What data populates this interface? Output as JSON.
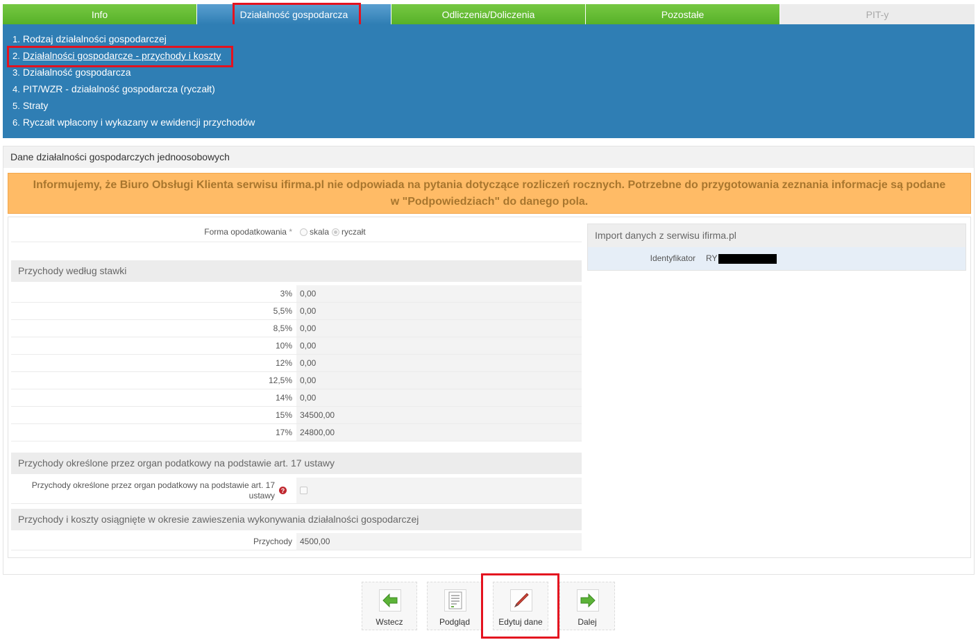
{
  "tabs": [
    {
      "label": "Info"
    },
    {
      "label": "Działalność gospodarcza"
    },
    {
      "label": "Odliczenia/Doliczenia"
    },
    {
      "label": "Pozostałe"
    },
    {
      "label": "PIT-y"
    }
  ],
  "subnav": [
    {
      "num": "1.",
      "label": "Rodzaj działalności gospodarczej"
    },
    {
      "num": "2.",
      "label": "Działalności gospodarcze - przychody i koszty"
    },
    {
      "num": "3.",
      "label": "Działalność gospodarcza"
    },
    {
      "num": "4.",
      "label": "PIT/WZR - działalność gospodarcza (ryczałt)"
    },
    {
      "num": "5.",
      "label": "Straty"
    },
    {
      "num": "6.",
      "label": "Ryczałt wpłacony i wykazany w ewidencji przychodów"
    }
  ],
  "panel": {
    "title": "Dane działalności gospodarczych jednoosobowych",
    "notice": "Informujemy, że Biuro Obsługi Klienta serwisu ifirma.pl nie odpowiada na pytania dotyczące rozliczeń rocznych. Potrzebne do przygotowania zeznania informacje są podane w \"Podpowiedziach\" do danego pola."
  },
  "form": {
    "tax_form": {
      "label": "Forma opodatkowania",
      "required": "*",
      "option_scale": "skala",
      "option_lump": "ryczałt",
      "selected": "ryczałt"
    },
    "rates_section": "Przychody według stawki",
    "rates": [
      {
        "rate": "3%",
        "value": "0,00"
      },
      {
        "rate": "5,5%",
        "value": "0,00"
      },
      {
        "rate": "8,5%",
        "value": "0,00"
      },
      {
        "rate": "10%",
        "value": "0,00"
      },
      {
        "rate": "12%",
        "value": "0,00"
      },
      {
        "rate": "12,5%",
        "value": "0,00"
      },
      {
        "rate": "14%",
        "value": "0,00"
      },
      {
        "rate": "15%",
        "value": "34500,00"
      },
      {
        "rate": "17%",
        "value": "24800,00"
      }
    ],
    "art17_section": "Przychody określone przez organ podatkowy na podstawie art. 17 ustawy",
    "art17_label": "Przychody określone przez organ podatkowy na podstawie art. 17 ustawy",
    "art17_help": "?",
    "suspension_section": "Przychody i koszty osiągnięte w okresie zawieszenia wykonywania działalności gospodarczej",
    "suspension_income": {
      "label": "Przychody",
      "value": "4500,00"
    }
  },
  "import": {
    "title": "Import danych z serwisu ifirma.pl",
    "id_label": "Identyfikator",
    "id_prefix": "RY"
  },
  "buttons": [
    {
      "label": "Wstecz",
      "icon": "arrow-left-icon"
    },
    {
      "label": "Podgląd",
      "icon": "document-preview-icon"
    },
    {
      "label": "Edytuj dane",
      "icon": "pen-icon"
    },
    {
      "label": "Dalej",
      "icon": "arrow-right-icon"
    }
  ],
  "colors": {
    "tab_green": "#57b128",
    "tab_blue": "#2f7eb4",
    "notice_bg": "#ffbb66",
    "highlight_red": "#e4121f"
  }
}
